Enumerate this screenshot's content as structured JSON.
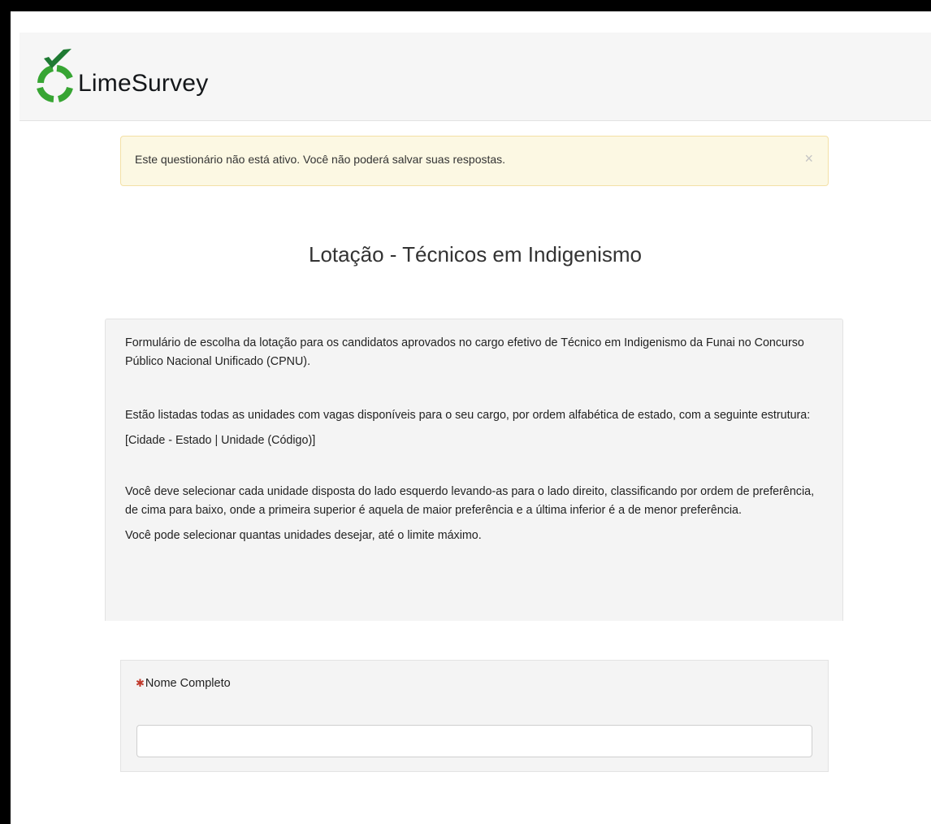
{
  "brand": {
    "name": "LimeSurvey",
    "logo_icon": "limesurvey-logo-icon",
    "green": "#37a533",
    "dark_green": "#1f7a33"
  },
  "alert": {
    "message": "Este questionário não está ativo. Você não poderá salvar suas respostas.",
    "close_symbol": "×"
  },
  "survey": {
    "title": "Lotação - Técnicos em Indigenismo",
    "description": {
      "p1": "Formulário de escolha da lotação para os candidatos aprovados no cargo efetivo de Técnico em Indigenismo da Funai no Concurso Público Nacional Unificado (CPNU).",
      "p2": "Estão listadas todas as unidades com vagas disponíveis para o seu cargo, por ordem alfabética de estado, com a seguinte estrutura:",
      "p3": "[Cidade - Estado | Unidade (Código)]",
      "p4": "Você deve selecionar cada unidade disposta do lado esquerdo levando-as para o lado direito, classificando por ordem de preferência, de cima para baixo, onde a primeira superior é aquela de maior preferência e a última inferior é a de menor preferência.",
      "p5": " Você pode selecionar quantas unidades desejar, até o limite máximo."
    }
  },
  "question": {
    "required_mark": "✱",
    "label": "Nome Completo",
    "value": ""
  }
}
